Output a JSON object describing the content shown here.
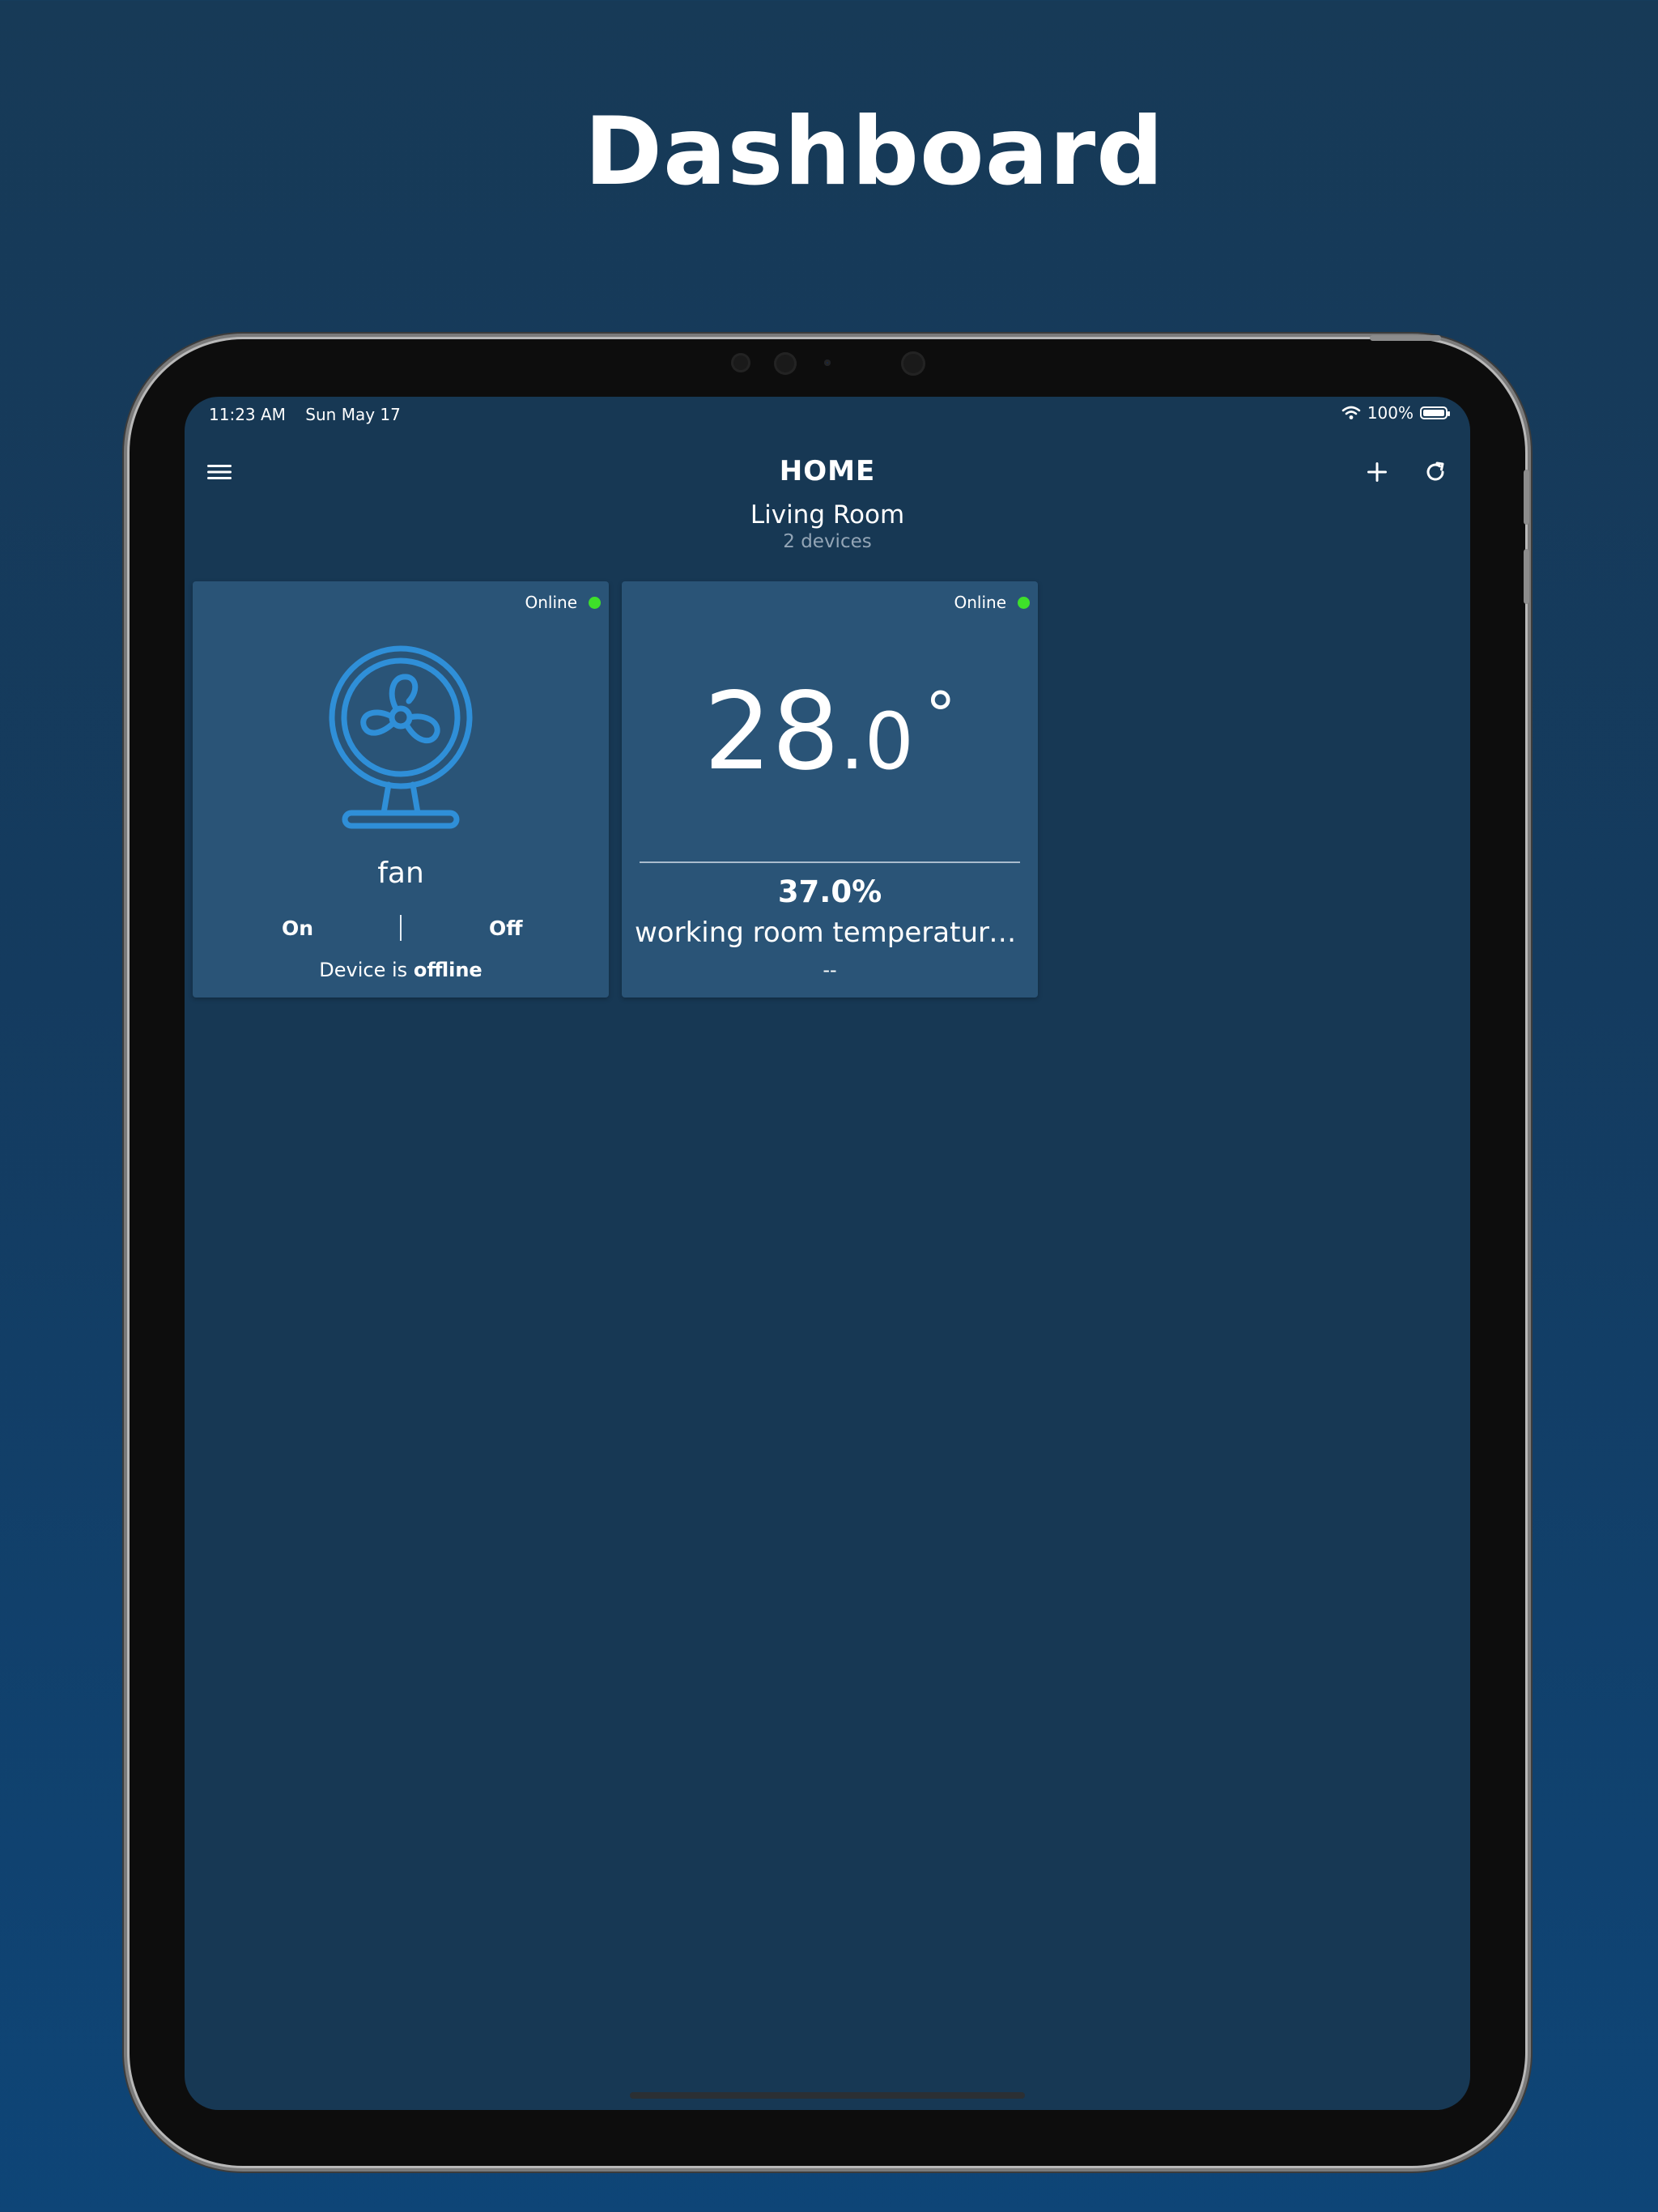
{
  "promo": {
    "title": "Dashboard"
  },
  "status_bar": {
    "time": "11:23 AM",
    "date": "Sun May 17",
    "battery": "100%",
    "wifi_icon": "wifi-icon",
    "battery_icon": "battery-icon"
  },
  "nav": {
    "title": "HOME",
    "menu_icon": "hamburger-menu-icon",
    "add_icon": "plus-icon",
    "refresh_icon": "refresh-icon"
  },
  "room": {
    "name": "Living Room",
    "device_count": "2 devices"
  },
  "devices": [
    {
      "status": "Online",
      "icon": "fan-icon",
      "name": "fan",
      "on_label": "On",
      "off_label": "Off",
      "message_prefix": "Device is",
      "message_state": "offline"
    },
    {
      "status": "Online",
      "temperature_whole": "28",
      "temperature_decimal": ".0",
      "degree_symbol": "°",
      "humidity": "37.0%",
      "name": "working room temperature…",
      "extra": "--"
    }
  ],
  "colors": {
    "card_bg": "#2a5477",
    "screen_bg": "#173854",
    "online_dot": "#3ee02a",
    "fan_icon": "#2f8fd8"
  }
}
